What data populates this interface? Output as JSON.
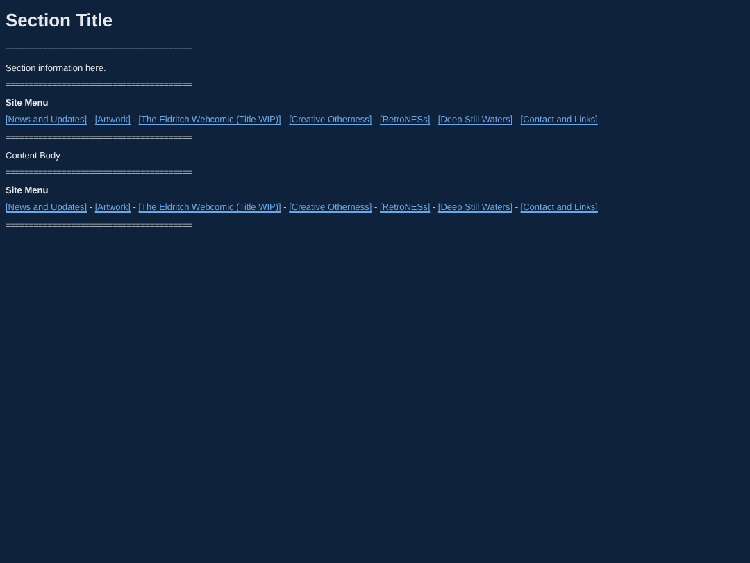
{
  "title": "Section Title",
  "blocks": [
    {
      "kind": "rule",
      "text": "========================================"
    },
    {
      "kind": "text",
      "text": "Section information here."
    },
    {
      "kind": "rule",
      "text": "========================================"
    },
    {
      "kind": "menu-title",
      "text": "Site Menu"
    },
    {
      "kind": "menu",
      "separator": " - ",
      "links": [
        "[News and Updates]",
        "[Artwork]",
        "[The Eldritch Webcomic (Title WIP)]",
        "[Creative Otherness]",
        "[RetroNESs]",
        "[Deep Still Waters]",
        "[Contact and Links]"
      ]
    },
    {
      "kind": "rule",
      "text": "========================================"
    },
    {
      "kind": "text",
      "text": "Content Body"
    },
    {
      "kind": "rule",
      "text": "========================================"
    },
    {
      "kind": "menu-title",
      "text": "Site Menu"
    },
    {
      "kind": "menu",
      "separator": " - ",
      "links": [
        "[News and Updates]",
        "[Artwork]",
        "[The Eldritch Webcomic (Title WIP)]",
        "[Creative Otherness]",
        "[RetroNESs]",
        "[Deep Still Waters]",
        "[Contact and Links]"
      ]
    },
    {
      "kind": "rule",
      "text": "========================================"
    }
  ]
}
